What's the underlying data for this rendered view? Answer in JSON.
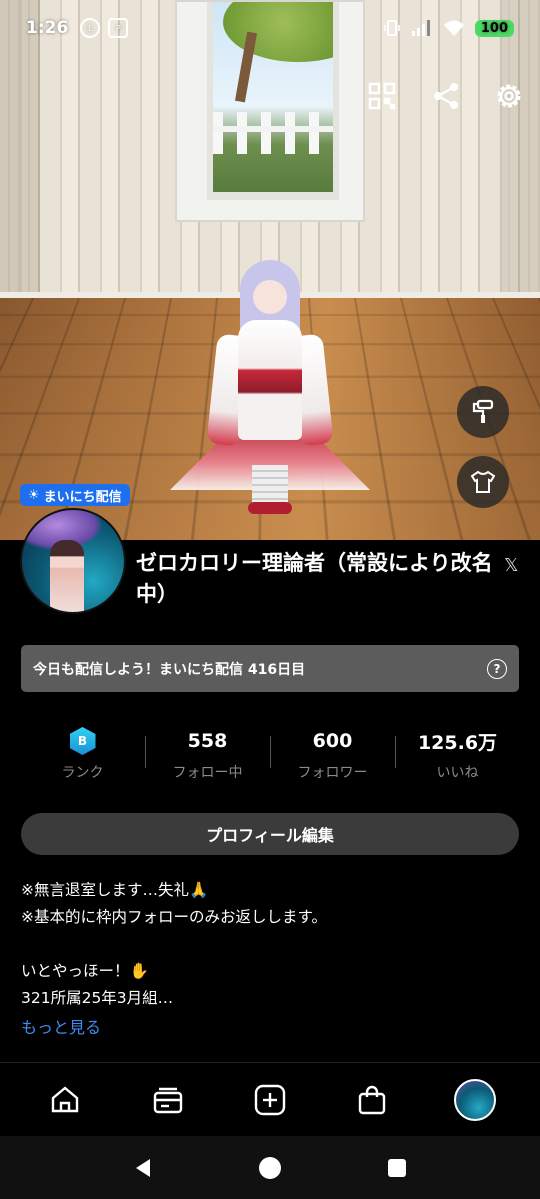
{
  "status_bar": {
    "time": "1:26",
    "battery": "100"
  },
  "daily_badge": "まいにち配信",
  "profile": {
    "display_name": "ゼロカロリー理論者（常設により改名中）",
    "daily_streak_text": "今日も配信しよう！まいにち配信 416日目"
  },
  "stats": [
    {
      "value": "",
      "label": "ランク",
      "rank_letter": "B"
    },
    {
      "value": "558",
      "label": "フォロー中"
    },
    {
      "value": "600",
      "label": "フォロワー"
    },
    {
      "value": "125.6万",
      "label": "いいね"
    }
  ],
  "edit_profile_label": "プロフィール編集",
  "bio_lines": [
    "※無言退室します…失礼🙏",
    "※基本的に枠内フォローのみお返しします。",
    "",
    "いとやっほー！✋",
    "321所属25年3月組…"
  ],
  "more_link": "もっと見る",
  "icons": {
    "qr": "qr-code-icon",
    "share": "share-icon",
    "settings": "gear-icon",
    "paint": "paint-roller-icon",
    "outfit": "tshirt-icon",
    "x": "x-logo-icon",
    "home": "home-icon",
    "feed": "feed-icon",
    "add": "plus-icon",
    "shop": "shopping-bag-icon"
  },
  "colors": {
    "accent_blue": "#1e6ff0",
    "link_blue": "#3f8bf0",
    "battery_green": "#4cd964"
  }
}
